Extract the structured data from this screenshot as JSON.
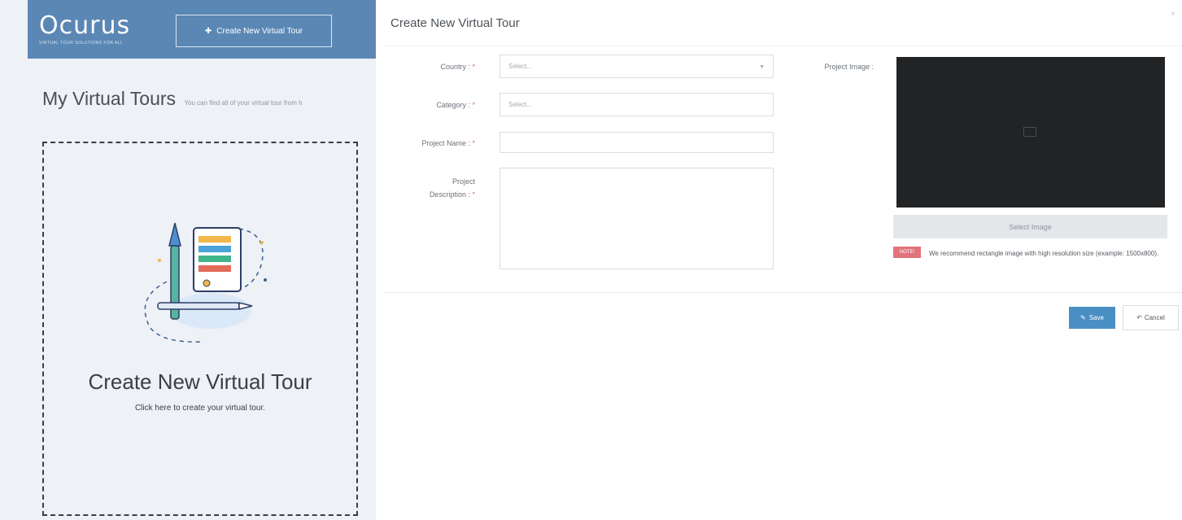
{
  "app": {
    "logo": "Ocurus",
    "logo_sub": "VIRTUAL TOUR SOLUTIONS FOR ALL",
    "create_button_label": "Create New Virtual Tour",
    "page_title": "My Virtual Tours",
    "page_subtitle": "You can find all of your virtual tour from h",
    "card_title": "Create New Virtual Tour",
    "card_subtitle": "Click here to create your virtual tour."
  },
  "modal": {
    "title": "Create New Virtual Tour",
    "close": "×",
    "fields": {
      "country": {
        "label": "Country :",
        "required": "*",
        "placeholder": "Select..."
      },
      "category": {
        "label": "Category :",
        "required": "*",
        "placeholder": "Select..."
      },
      "project_name": {
        "label": "Project Name :",
        "required": "*",
        "value": ""
      },
      "project_description": {
        "label_line1": "Project",
        "label_line2": "Description :",
        "required": "*",
        "value": ""
      }
    },
    "project_image": {
      "label": "Project Image :",
      "select_button": "Select Image",
      "note_badge": "NOTE!",
      "note_text": "We recommend rectangle image with high resolution size (example: 1500x800)."
    },
    "buttons": {
      "save": "Save",
      "cancel": "Cancel"
    }
  },
  "colors": {
    "topbar": "#5b87b5",
    "save_button": "#4a8fc4",
    "note_badge": "#e2737a",
    "image_preview": "#222324"
  }
}
